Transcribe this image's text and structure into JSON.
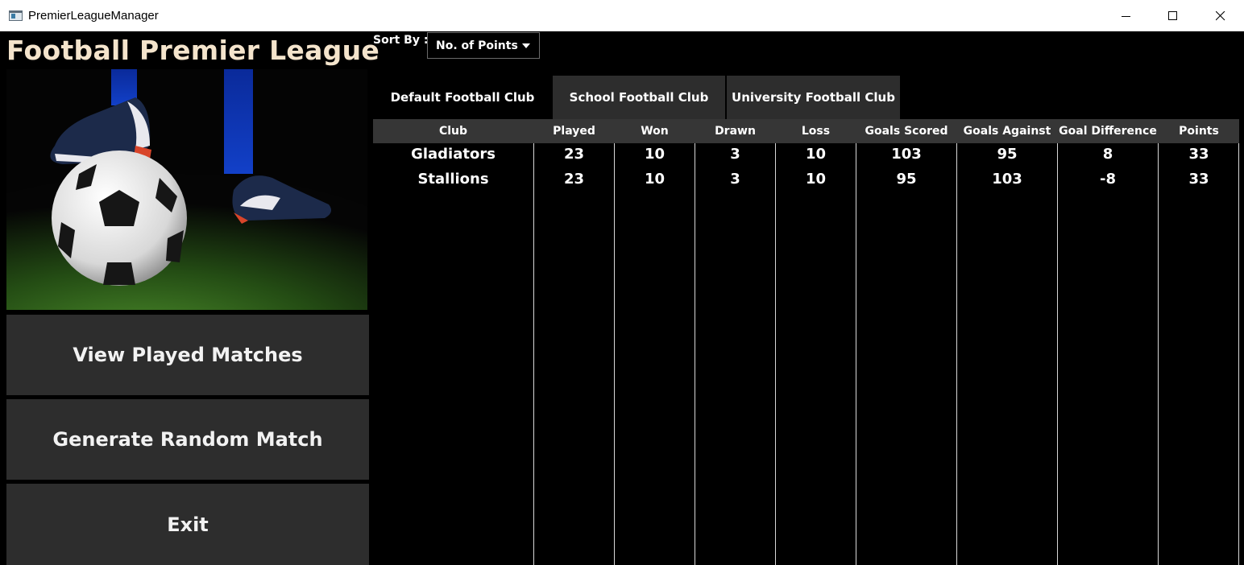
{
  "window": {
    "title": "PremierLeagueManager",
    "controls": [
      "minimize-icon",
      "maximize-icon",
      "close-icon"
    ]
  },
  "sidebar": {
    "title": "Football Premier League",
    "hero_image": "soccer-ball-under-cleat",
    "buttons": [
      {
        "label": "View Played Matches"
      },
      {
        "label": "Generate Random Match"
      },
      {
        "label": "Exit"
      }
    ]
  },
  "sort": {
    "label": "Sort By :",
    "selected": "No. of Points"
  },
  "tabs": [
    {
      "label": "Default Football Club",
      "active": true
    },
    {
      "label": "School Football Club",
      "active": false
    },
    {
      "label": "University Football Club",
      "active": false
    }
  ],
  "table": {
    "columns": [
      "Club",
      "Played",
      "Won",
      "Drawn",
      "Loss",
      "Goals Scored",
      "Goals Against",
      "Goal Difference",
      "Points"
    ],
    "rows": [
      [
        "Gladiators",
        "23",
        "10",
        "3",
        "10",
        "103",
        "95",
        "8",
        "33"
      ],
      [
        "Stallions",
        "23",
        "10",
        "3",
        "10",
        "95",
        "103",
        "-8",
        "33"
      ]
    ]
  },
  "colors": {
    "background": "#000000",
    "panel": "#2d2d2d",
    "header": "#363636",
    "title_text": "#f4e4cc",
    "text": "#ffffff"
  }
}
